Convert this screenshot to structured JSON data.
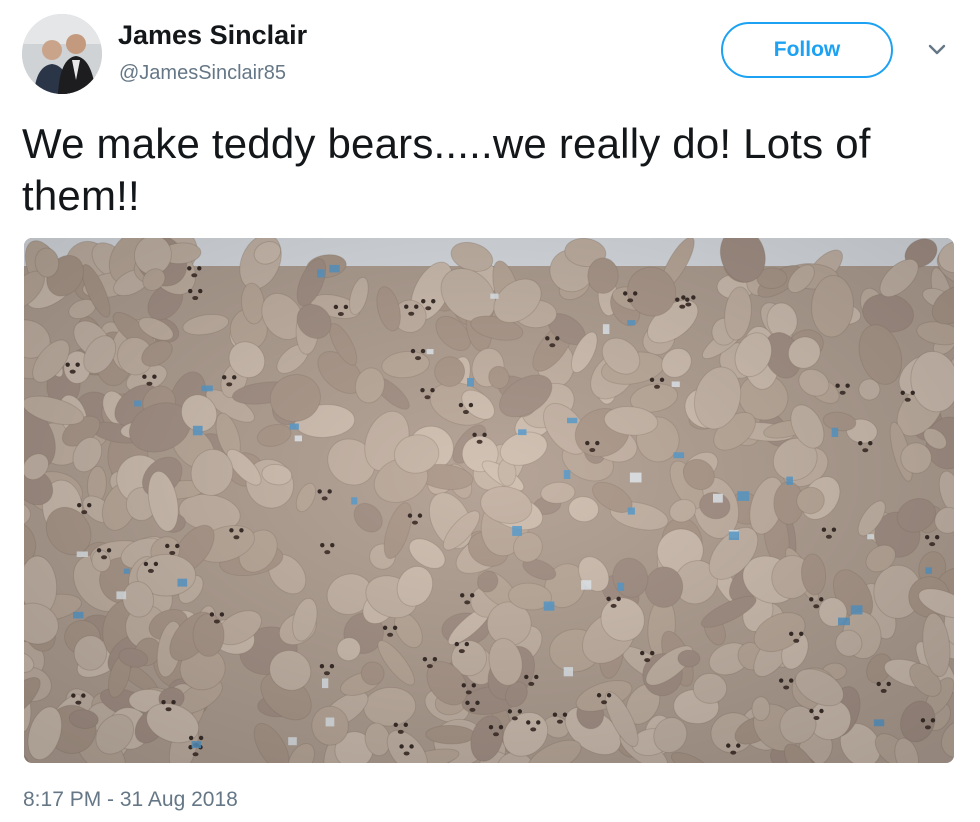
{
  "user": {
    "name": "James Sinclair",
    "handle": "@JamesSinclair85"
  },
  "follow_label": "Follow",
  "tweet": {
    "text": "We make teddy bears.....we really do! Lots of them!!",
    "timestamp": "8:17 PM - 31 Aug 2018"
  },
  "icons": {
    "menu": "chevron-down-icon"
  },
  "colors": {
    "accent": "#1da1f2",
    "secondary_text": "#657786",
    "primary_text": "#14171a"
  }
}
